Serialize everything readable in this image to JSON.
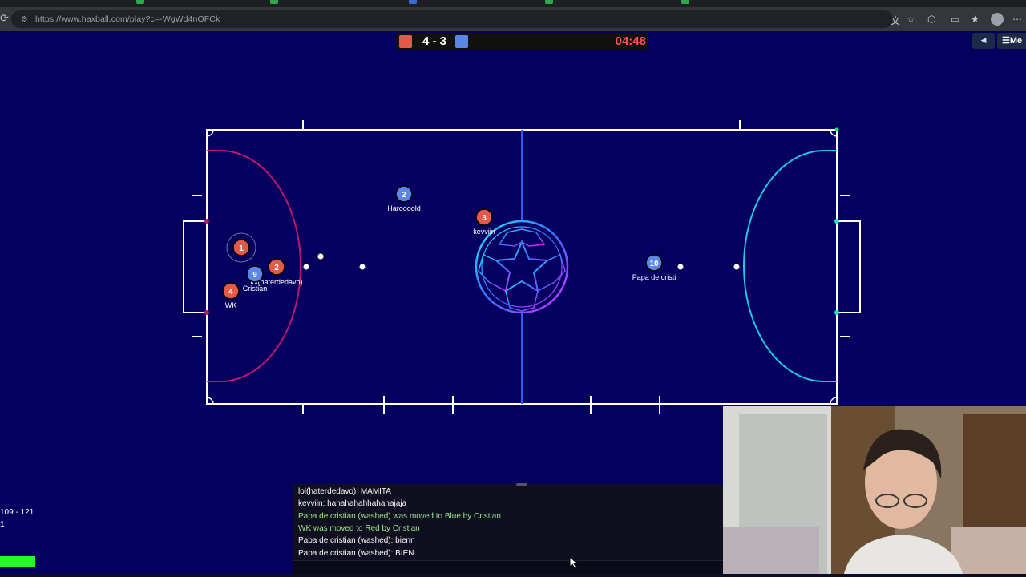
{
  "browser": {
    "url": "https://www.haxball.com/play?c=-WgWd4nOFCk"
  },
  "scoreboard": {
    "score": "4 - 3",
    "timer": "04:48",
    "red_color": "#e5594a",
    "blue_color": "#5a86e6"
  },
  "menu": {
    "sound_icon": "speaker-icon",
    "menu_label": "Me"
  },
  "field": {
    "background": "#05005f",
    "red_area_color": "#c0166e",
    "blue_area_color": "#20c8e8",
    "center_line_color": "#2a5dff"
  },
  "players": [
    {
      "team": "red",
      "number": "1",
      "name": ""
    },
    {
      "team": "red",
      "number": "2",
      "name": "lol(haterdedavo)"
    },
    {
      "team": "red",
      "number": "3",
      "name": "kevviin"
    },
    {
      "team": "red",
      "number": "4",
      "name": "WK"
    },
    {
      "team": "blue",
      "number": "2",
      "name": "Haroooold"
    },
    {
      "team": "blue",
      "number": "9",
      "name": "Cristian"
    },
    {
      "team": "blue",
      "number": "10",
      "name": "Papa de cristi"
    }
  ],
  "stats": {
    "line1": "109 - 121",
    "line2": "1"
  },
  "chat": {
    "lines": [
      {
        "type": "msg",
        "text": "lol(haterdedavo): MAMITA"
      },
      {
        "type": "msg",
        "text": "kevviin: hahahahahhahahajaja"
      },
      {
        "type": "sys",
        "text": "Papa de cristian (washed) was moved to Blue by Cristian"
      },
      {
        "type": "sys",
        "text": "WK was moved to Red by Cristian"
      },
      {
        "type": "msg",
        "text": "Papa de cristian (washed): bienn"
      },
      {
        "type": "msg",
        "text": "Papa de cristian (washed): BIEN"
      }
    ],
    "input_value": ""
  }
}
